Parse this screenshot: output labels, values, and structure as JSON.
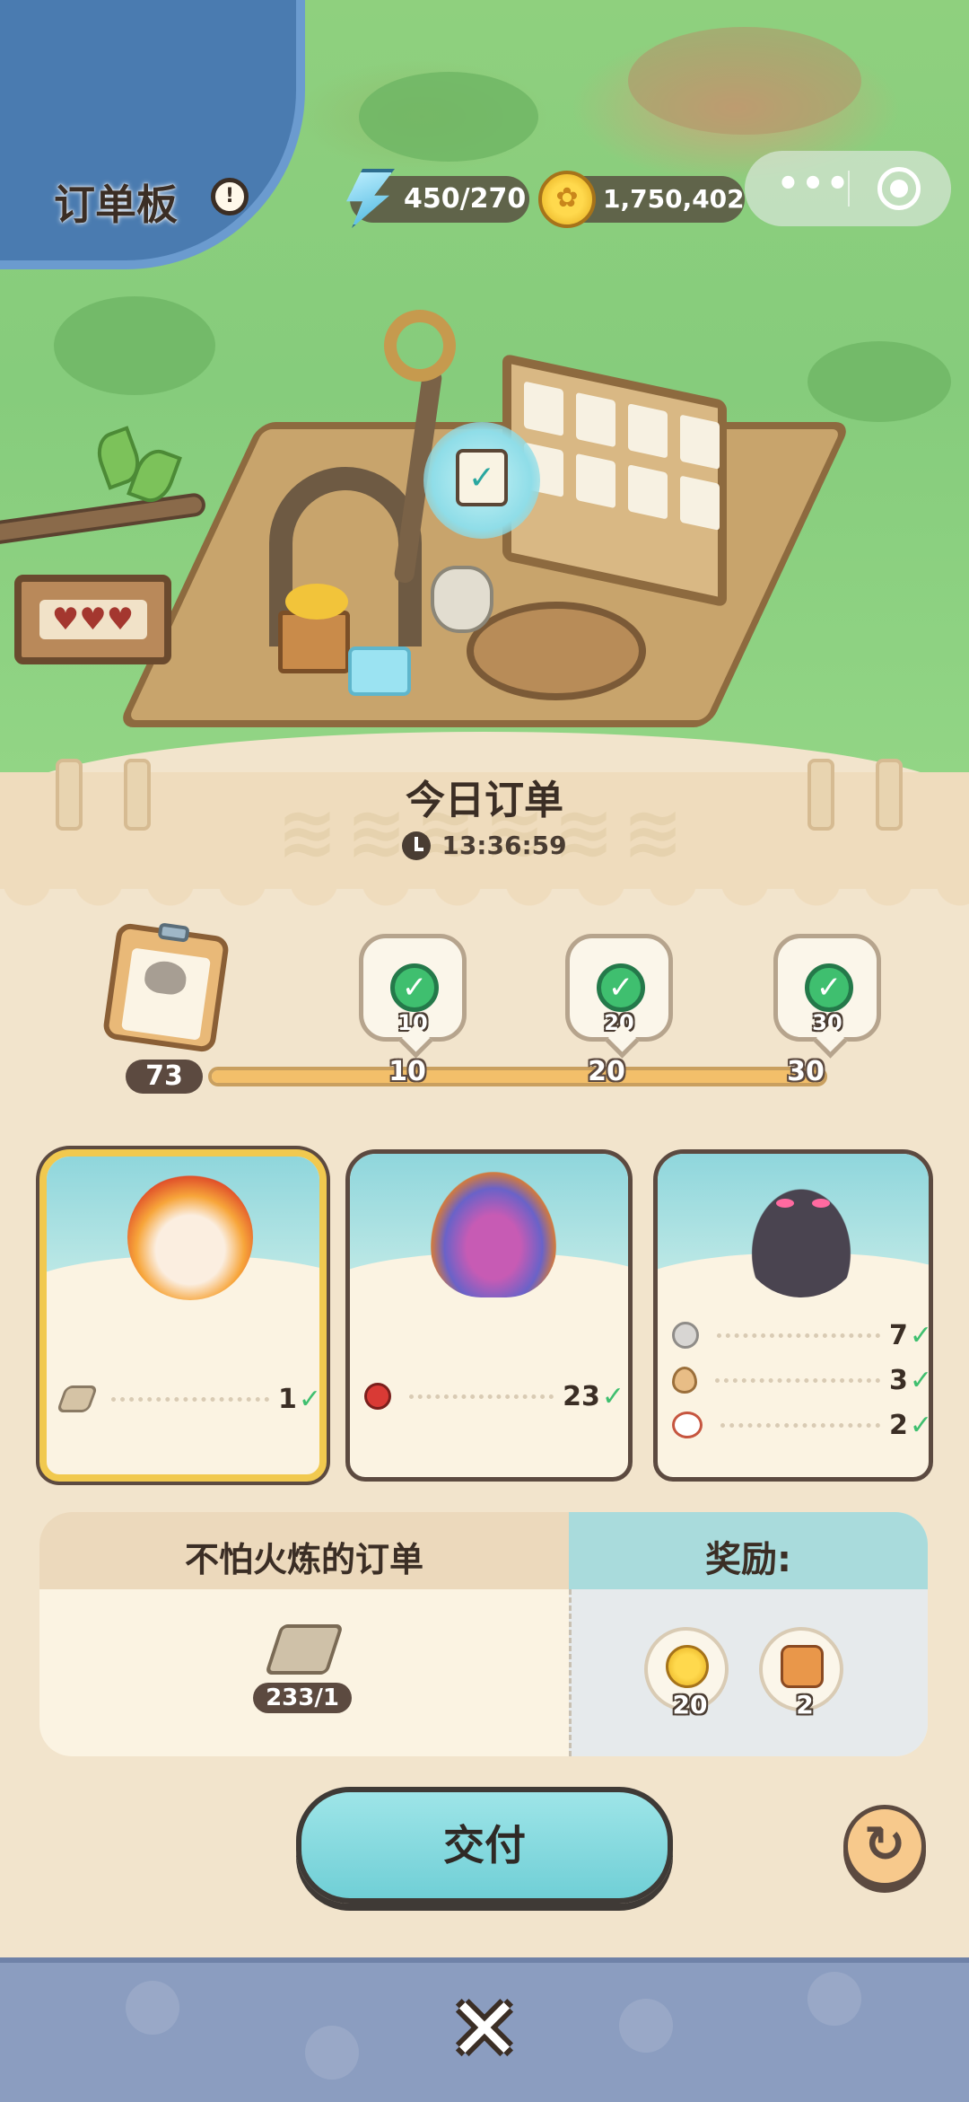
{
  "hud": {
    "title": "订单板",
    "energy": "450/270",
    "coins": "1,750,402"
  },
  "panel": {
    "title": "今日订单",
    "timer": "13:36:59"
  },
  "progress": {
    "count": "73",
    "max": 30,
    "fill_fraction": 1.0,
    "milestones": [
      {
        "value": "10",
        "label": "10"
      },
      {
        "value": "20",
        "label": "20"
      },
      {
        "value": "30",
        "label": "30"
      }
    ]
  },
  "orders": [
    {
      "creature": "fire-beast",
      "selected": true,
      "requirements": [
        {
          "icon": "wood-plank-icon",
          "qty": "1",
          "done": true
        }
      ]
    },
    {
      "creature": "sea-dragon",
      "selected": false,
      "requirements": [
        {
          "icon": "apple-icon",
          "qty": "23",
          "done": true
        }
      ]
    },
    {
      "creature": "shadow-slime",
      "selected": false,
      "requirements": [
        {
          "icon": "stone-icon",
          "qty": "7",
          "done": true
        },
        {
          "icon": "egg-icon",
          "qty": "3",
          "done": true
        },
        {
          "icon": "dish-icon",
          "qty": "2",
          "done": true
        }
      ]
    }
  ],
  "detail": {
    "order_name": "不怕火炼的订单",
    "item_count": "233/1",
    "reward_label": "奖励:",
    "rewards": [
      {
        "icon": "coin-icon",
        "amount": "20"
      },
      {
        "icon": "canned-food-icon",
        "amount": "2"
      }
    ]
  },
  "buttons": {
    "deliver": "交付",
    "close": "✕"
  },
  "colors": {
    "accent_teal": "#70cfd6",
    "selected_gold": "#f1c94f",
    "check_green": "#3fbf6f",
    "panel_bg": "#f2e4cc",
    "bottom_bar": "#8b9dc0"
  }
}
